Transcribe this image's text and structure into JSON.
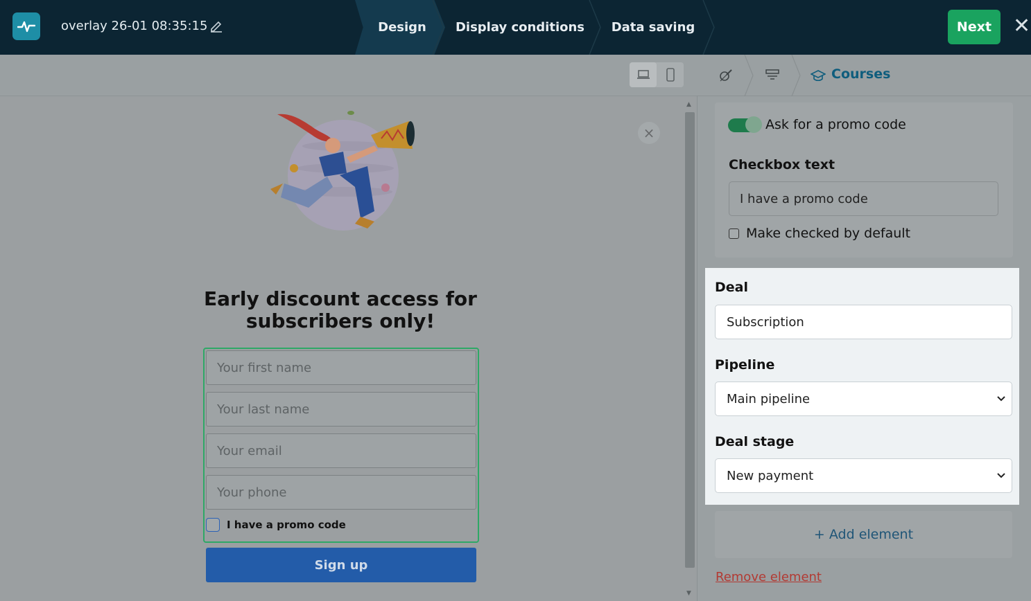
{
  "header": {
    "title": "overlay 26-01 08:35:15",
    "steps": [
      "Design",
      "Display conditions",
      "Data saving"
    ],
    "active_step": "Design",
    "next_label": "Next",
    "close_glyph": "✕"
  },
  "preview": {
    "headline_line1": "Early discount access for",
    "headline_line2": "subscribers only!",
    "inputs": [
      {
        "placeholder": "Your first name"
      },
      {
        "placeholder": "Your last name"
      },
      {
        "placeholder": "Your email"
      },
      {
        "placeholder": "Your phone"
      }
    ],
    "checkbox_label": "I have a promo code",
    "submit_label": "Sign up",
    "close_glyph": "×"
  },
  "panel": {
    "breadcrumb_current": "Courses",
    "promo": {
      "toggle_label": "Ask for a promo code",
      "toggle_on": true,
      "checkbox_text_label": "Checkbox text",
      "checkbox_text_value": "I have a promo code",
      "default_checked_label": "Make checked by default"
    },
    "deal": {
      "deal_label": "Deal",
      "deal_value": "Subscription",
      "pipeline_label": "Pipeline",
      "pipeline_value": "Main pipeline",
      "stage_label": "Deal stage",
      "stage_value": "New payment"
    },
    "add_element_label": "+ Add element",
    "remove_element_label": "Remove element"
  },
  "colors": {
    "topbar": "#0c2533",
    "next_button": "#1aa35f",
    "form_border": "#2ea866",
    "submit": "#235ca9",
    "remove_link": "#b23a33"
  }
}
